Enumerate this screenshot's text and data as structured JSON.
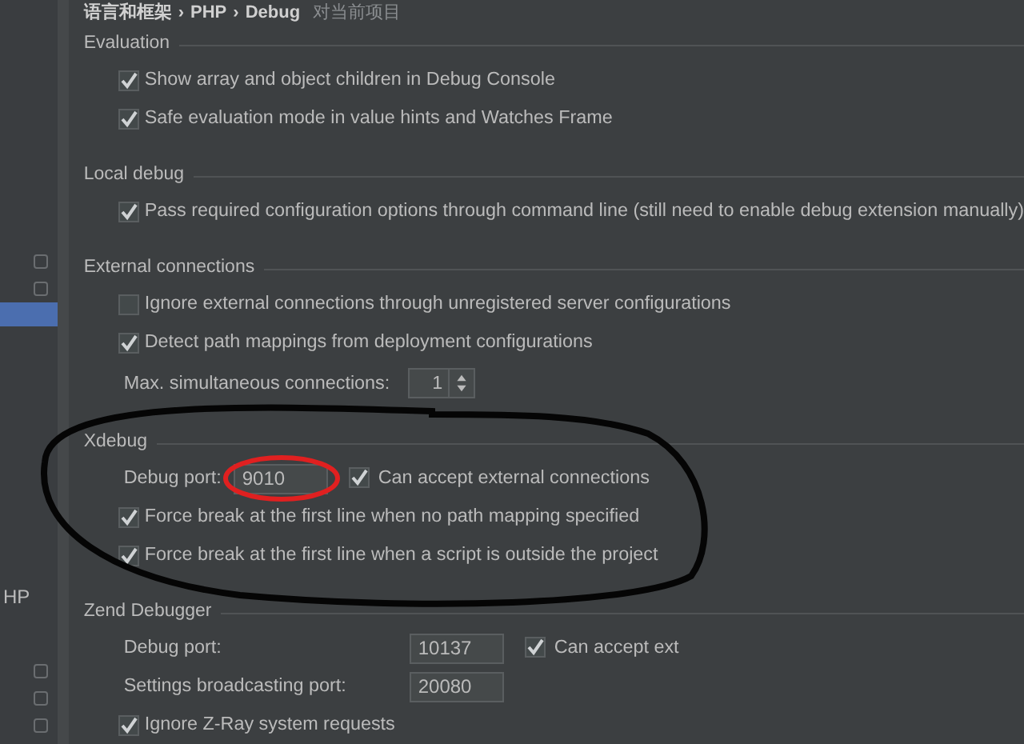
{
  "breadcrumb": {
    "path": [
      "语言和框架",
      "PHP",
      "Debug"
    ],
    "separator": "›",
    "scope": "对当前项目"
  },
  "sidebar": {
    "items": [
      {
        "kind": "icon",
        "selected": false
      },
      {
        "kind": "icon",
        "selected": false
      },
      {
        "kind": "blank",
        "selected": true
      },
      {
        "kind": "text",
        "label": "HP",
        "selected": false
      },
      {
        "kind": "icon",
        "selected": false
      },
      {
        "kind": "icon",
        "selected": false
      },
      {
        "kind": "icon",
        "selected": false
      }
    ]
  },
  "sections": [
    {
      "title": "Evaluation",
      "rows": [
        {
          "kind": "checkbox",
          "label": "Show array and object children in Debug Console",
          "checked": true
        },
        {
          "kind": "checkbox",
          "label": "Safe evaluation mode in value hints and Watches Frame",
          "checked": true
        }
      ]
    },
    {
      "title": "Local debug",
      "rows": [
        {
          "kind": "checkbox",
          "label": "Pass required configuration options through command line (still need to enable debug extension manually)",
          "checked": true
        }
      ]
    },
    {
      "title": "External connections",
      "rows": [
        {
          "kind": "checkbox",
          "label": "Ignore external connections through unregistered server configurations",
          "checked": false
        },
        {
          "kind": "checkbox",
          "label": "Detect path mappings from deployment configurations",
          "checked": true
        },
        {
          "kind": "spinner",
          "label": "Max. simultaneous connections:",
          "value": "1"
        }
      ]
    },
    {
      "title": "Xdebug",
      "rows": [
        {
          "kind": "inline_field",
          "label": "Debug port:",
          "value": "9010",
          "option": {
            "label": "Can accept external connections",
            "checked": true
          }
        },
        {
          "kind": "checkbox",
          "label": "Force break at the first line when no path mapping specified",
          "checked": true
        },
        {
          "kind": "checkbox",
          "label": "Force break at the first line when a script is outside the project",
          "checked": true
        }
      ]
    },
    {
      "title": "Zend Debugger",
      "rows": [
        {
          "kind": "aligned_field",
          "label": "Debug port:",
          "value": "10137",
          "option": {
            "label": "Can accept ext",
            "checked": true
          }
        },
        {
          "kind": "aligned_field",
          "label": "Settings broadcasting port:",
          "value": "20080"
        },
        {
          "kind": "checkbox",
          "label": "Ignore Z-Ray system requests",
          "checked": true
        }
      ]
    }
  ]
}
